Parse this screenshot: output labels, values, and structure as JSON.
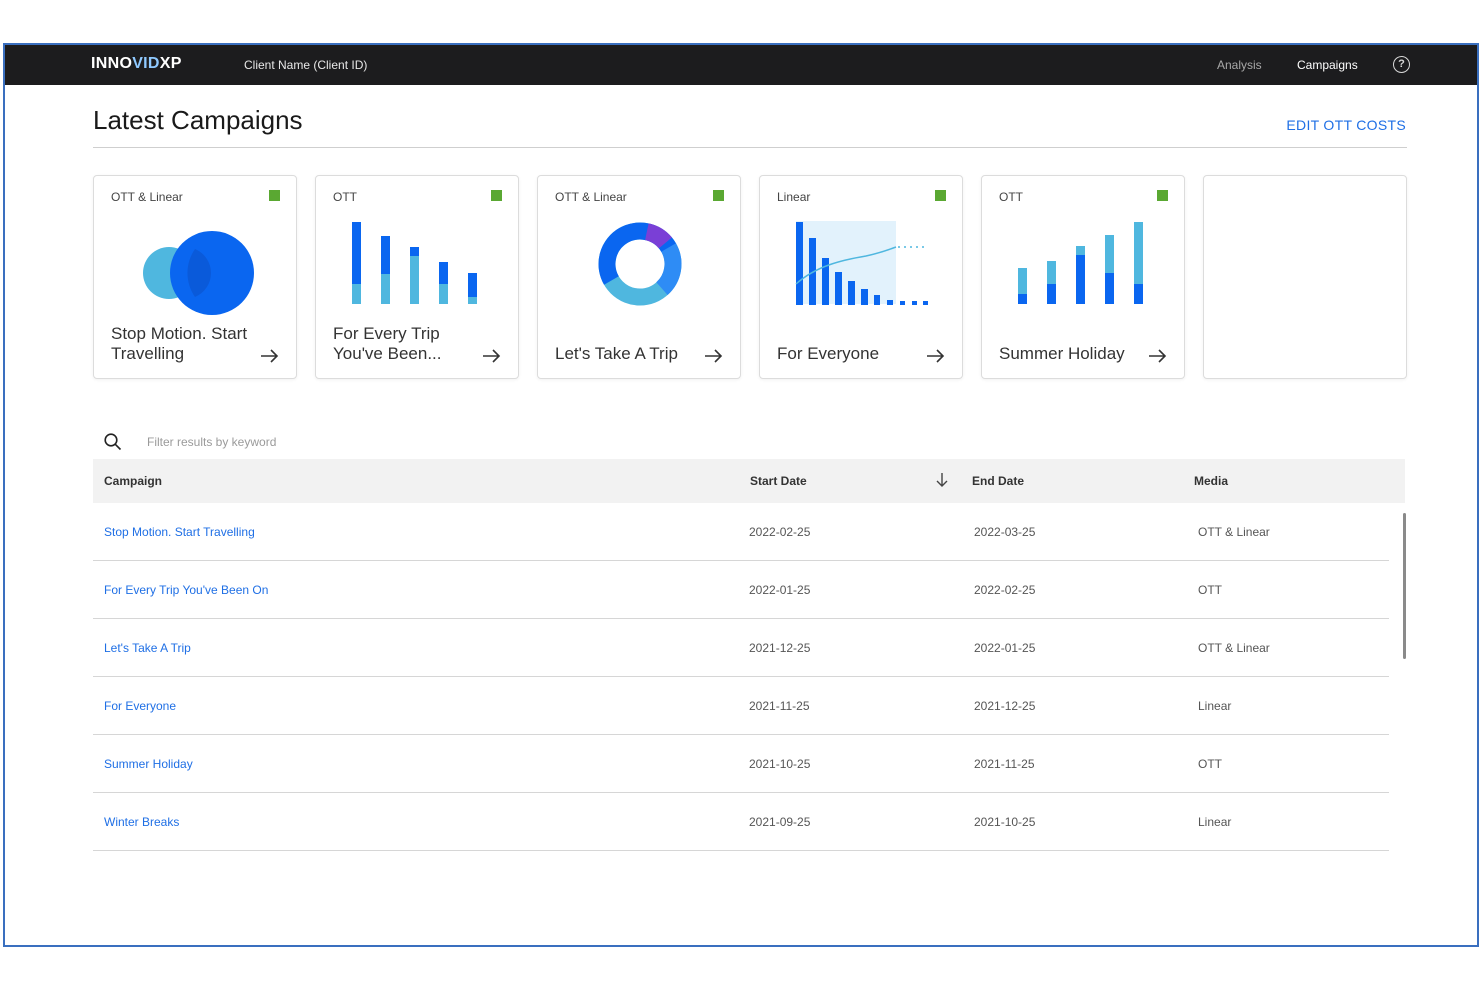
{
  "header": {
    "brand": "INNOVID XP",
    "brand_parts": [
      "INNO",
      "VID",
      "XP"
    ],
    "client": "Client Name (Client ID)",
    "nav": [
      {
        "label": "Analysis"
      },
      {
        "label": "Campaigns"
      }
    ],
    "help_icon": "help-circle-icon",
    "help_glyph": "?"
  },
  "page": {
    "title": "Latest Campaigns",
    "edit_link": "EDIT OTT COSTS"
  },
  "colors": {
    "brand_blue": "#0a66f0",
    "light_blue": "#4fb7df",
    "link_blue": "#1f6fe5",
    "status_green": "#5aa832",
    "purple": "#7a3fd6",
    "topbar": "#1c1c1e"
  },
  "cards": [
    {
      "media": "OTT & Linear",
      "name": "Stop Motion. Start Travelling",
      "viz": "venn",
      "arrow_icon": "arrow-right-icon"
    },
    {
      "media": "OTT",
      "name": "For Every Trip You've Been...",
      "viz": "stacked-bars-descending",
      "arrow_icon": "arrow-right-icon"
    },
    {
      "media": "OTT & Linear",
      "name": "Let's Take A Trip",
      "viz": "donut",
      "arrow_icon": "arrow-right-icon"
    },
    {
      "media": "Linear",
      "name": "For Everyone",
      "viz": "bars-with-trendline",
      "arrow_icon": "arrow-right-icon"
    },
    {
      "media": "OTT",
      "name": "Summer Holiday",
      "viz": "stacked-bars-ascending",
      "arrow_icon": "arrow-right-icon"
    }
  ],
  "search": {
    "placeholder": "Filter results by keyword",
    "icon": "search-icon"
  },
  "table": {
    "columns": [
      "Campaign",
      "Start Date",
      "End Date",
      "Media"
    ],
    "sort": {
      "column": "Start Date",
      "direction": "descending",
      "icon": "arrow-down-icon"
    },
    "rows": [
      {
        "campaign": "Stop Motion. Start Travelling",
        "start": "2022-02-25",
        "end": "2022-03-25",
        "media": "OTT & Linear"
      },
      {
        "campaign": "For Every Trip You've Been On",
        "start": "2022-01-25",
        "end": "2022-02-25",
        "media": "OTT"
      },
      {
        "campaign": "Let's Take A Trip",
        "start": "2021-12-25",
        "end": "2022-01-25",
        "media": "OTT & Linear"
      },
      {
        "campaign": "For Everyone",
        "start": "2021-11-25",
        "end": "2021-12-25",
        "media": "Linear"
      },
      {
        "campaign": "Summer Holiday",
        "start": "2021-10-25",
        "end": "2021-11-25",
        "media": "OTT"
      },
      {
        "campaign": "Winter Breaks",
        "start": "2021-09-25",
        "end": "2021-10-25",
        "media": "Linear"
      }
    ]
  }
}
